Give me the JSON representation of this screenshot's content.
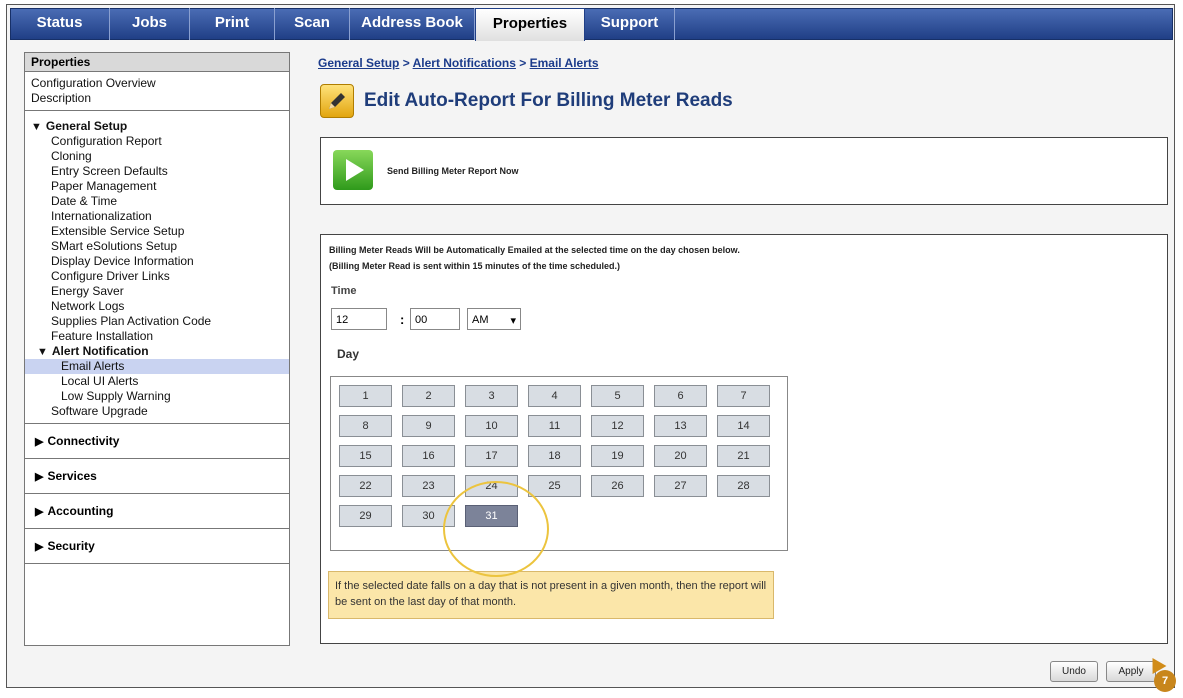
{
  "nav": {
    "tabs": [
      {
        "label": "Status"
      },
      {
        "label": "Jobs"
      },
      {
        "label": "Print"
      },
      {
        "label": "Scan"
      },
      {
        "label": "Address Book"
      },
      {
        "label": "Properties"
      },
      {
        "label": "Support"
      }
    ],
    "active_tab": "Properties"
  },
  "sidebar": {
    "title": "Properties",
    "overview": [
      "Configuration Overview",
      "Description"
    ],
    "general_setup": {
      "label": "General Setup",
      "items": [
        "Configuration Report",
        "Cloning",
        "Entry Screen Defaults",
        "Paper Management",
        "Date & Time",
        "Internationalization",
        "Extensible Service Setup",
        "SMart eSolutions Setup",
        "Display Device Information",
        "Configure Driver Links",
        "Energy Saver",
        "Network Logs",
        "Supplies Plan Activation Code",
        "Feature Installation"
      ],
      "alert_notification": {
        "label": "Alert Notification",
        "items": [
          "Email Alerts",
          "Local UI Alerts",
          "Low Supply Warning"
        ],
        "selected": "Email Alerts"
      },
      "trailing": "Software Upgrade"
    },
    "collapsed": [
      "Connectivity",
      "Services",
      "Accounting",
      "Security"
    ]
  },
  "breadcrumb": {
    "part1": "General Setup",
    "sep": " > ",
    "part2": "Alert Notifications",
    "part3": "Email Alerts"
  },
  "page": {
    "title": "Edit Auto-Report For Billing Meter Reads",
    "send_now": "Send Billing Meter Report Now",
    "info1": "Billing Meter Reads Will be Automatically Emailed at the selected time on the day chosen below.",
    "info2": "(Billing Meter Read is sent within 15 minutes of the time scheduled.)",
    "time_label": "Time",
    "hour": "12",
    "colon": ":",
    "minute": "00",
    "ampm": "AM",
    "day_label": "Day",
    "days": [
      "1",
      "2",
      "3",
      "4",
      "5",
      "6",
      "7",
      "8",
      "9",
      "10",
      "11",
      "12",
      "13",
      "14",
      "15",
      "16",
      "17",
      "18",
      "19",
      "20",
      "21",
      "22",
      "23",
      "24",
      "25",
      "26",
      "27",
      "28",
      "29",
      "30",
      "31"
    ],
    "selected_day": "31",
    "note": "If the selected date falls on a day that is not present in a given month, then the report will be sent on the last day of that month."
  },
  "buttons": {
    "undo": "Undo",
    "apply": "Apply"
  },
  "step_badge": "7"
}
